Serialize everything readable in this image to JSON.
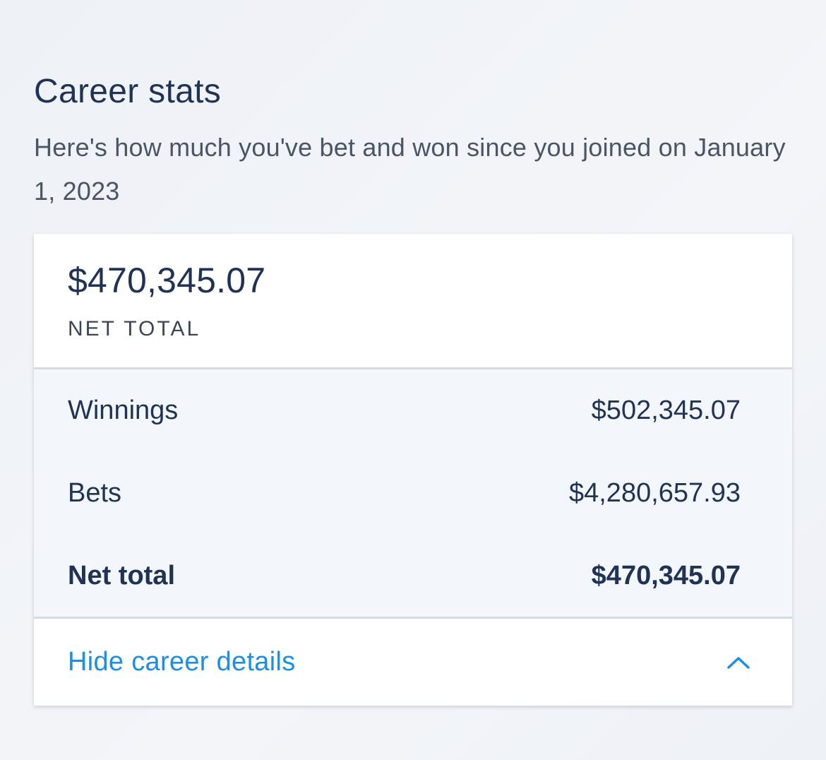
{
  "header": {
    "title": "Career stats",
    "subtitle": "Here's how much you've bet and won since you joined on January 1, 2023"
  },
  "summary": {
    "amount": "$470,345.07",
    "label": "NET TOTAL"
  },
  "details": {
    "rows": [
      {
        "label": "Winnings",
        "value": "$502,345.07"
      },
      {
        "label": "Bets",
        "value": "$4,280,657.93"
      },
      {
        "label": "Net total",
        "value": "$470,345.07"
      }
    ]
  },
  "footer": {
    "toggle_label": "Hide career details",
    "toggle_icon": "chevron-up-icon"
  },
  "colors": {
    "primary_text": "#1f3354",
    "link": "#1b8fe3",
    "details_bg": "#f3f6fb"
  }
}
